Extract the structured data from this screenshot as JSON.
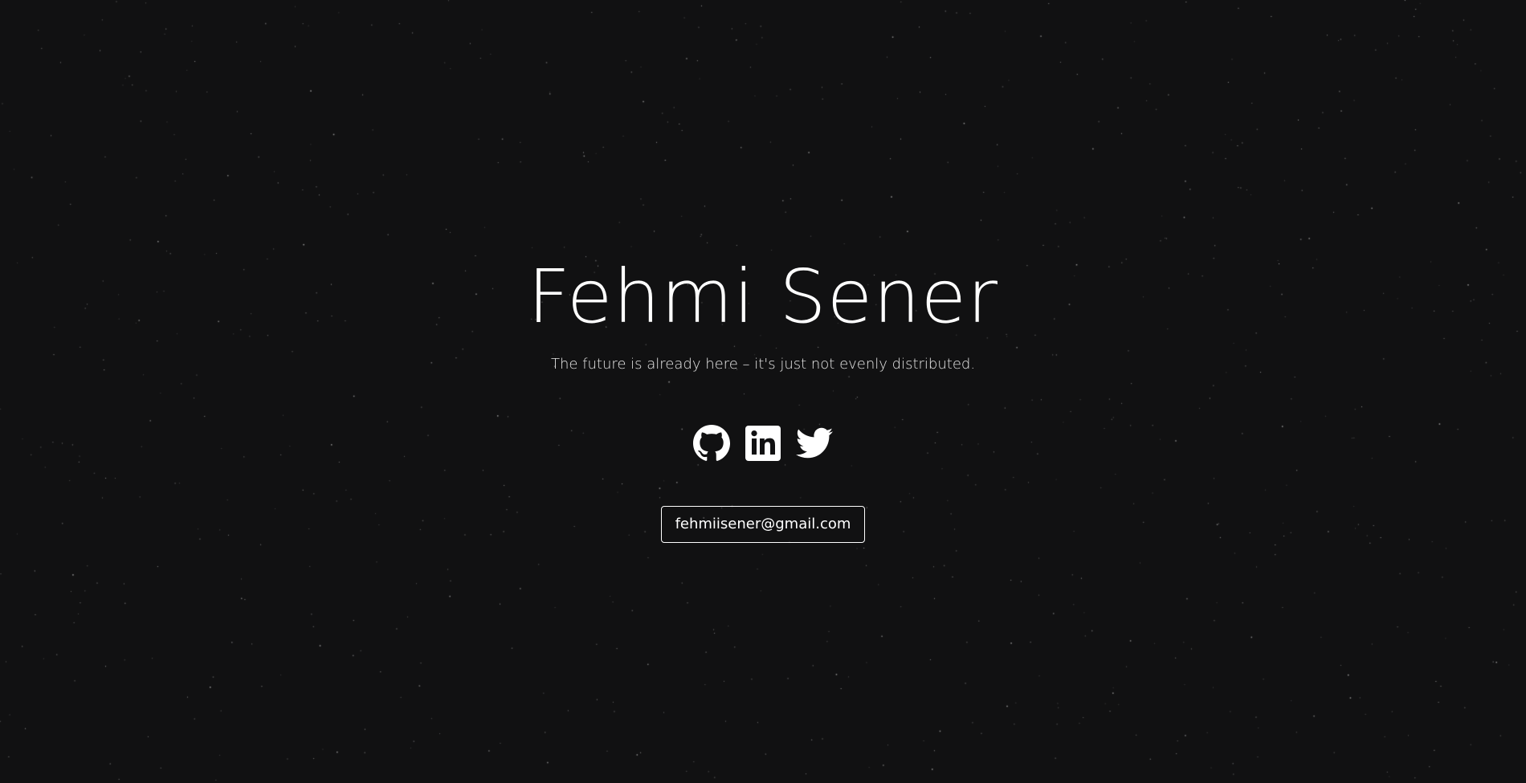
{
  "profile": {
    "name": "Fehmi Sener",
    "tagline": "The future is already here – it's just not evenly distributed."
  },
  "socials": [
    {
      "icon": "github-icon"
    },
    {
      "icon": "linkedin-icon"
    },
    {
      "icon": "twitter-icon"
    }
  ],
  "contact": {
    "email": "fehmiisener@gmail.com"
  },
  "colors": {
    "background": "#111112",
    "text": "#ffffff",
    "star": "#8a8a8a"
  }
}
